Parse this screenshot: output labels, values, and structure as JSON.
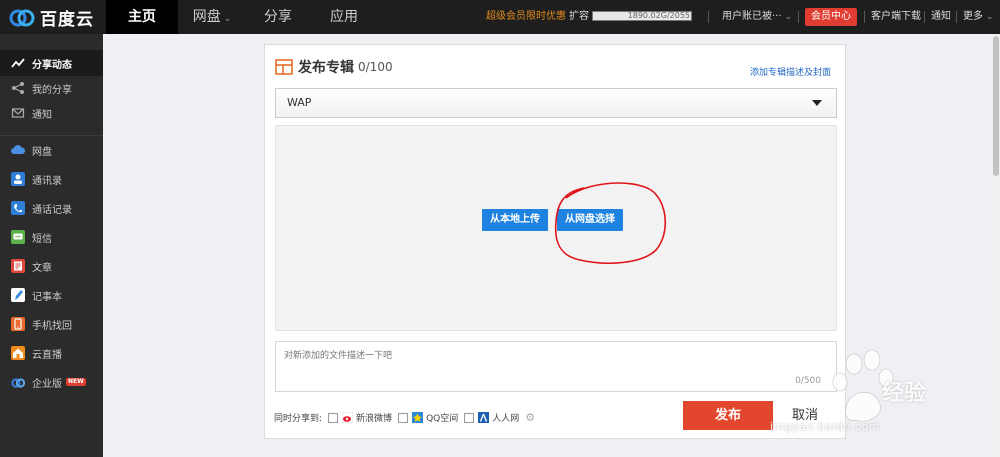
{
  "app": {
    "brand": "百度云",
    "nav": [
      {
        "label": "主页",
        "active": true
      },
      {
        "label": "网盘",
        "dropdown": true
      },
      {
        "label": "分享"
      },
      {
        "label": "应用"
      }
    ],
    "promo_vip": "超级会员",
    "promo_offer": "限时优惠",
    "quota_label": "扩容",
    "quota_text": "1890.02G/2055",
    "user_label": "用户账已被···",
    "vip_center": "会员中心",
    "client_download": "客户端下载",
    "notify": "通知",
    "more": "更多"
  },
  "sidebar": {
    "items": [
      {
        "label": "分享动态",
        "icon": "activity-icon",
        "active": true
      },
      {
        "label": "我的分享",
        "icon": "share-icon"
      },
      {
        "label": "通知",
        "icon": "mail-icon"
      },
      {
        "label": "网盘",
        "icon": "cloud-icon",
        "color": "#4a90e2"
      },
      {
        "label": "通讯录",
        "icon": "contacts-icon",
        "color": "#2f7fd8"
      },
      {
        "label": "通话记录",
        "icon": "call-log-icon",
        "color": "#2f7fd8"
      },
      {
        "label": "短信",
        "icon": "sms-icon",
        "color": "#5bb04a"
      },
      {
        "label": "文章",
        "icon": "article-icon",
        "color": "#e0483d"
      },
      {
        "label": "记事本",
        "icon": "notepad-icon",
        "color": "#3a8ae0"
      },
      {
        "label": "手机找回",
        "icon": "phone-find-icon",
        "color": "#e86a2a"
      },
      {
        "label": "云直播",
        "icon": "live-icon",
        "color": "#f08a1c"
      },
      {
        "label": "企业版",
        "icon": "enterprise-icon",
        "color": "#3b7fe0",
        "badge": "NEW"
      }
    ]
  },
  "card": {
    "title": "发布专辑",
    "count": "0/100",
    "add_link": "添加专辑描述及封面",
    "select_value": "WAP",
    "upload_local": "从本地上传",
    "upload_netdisk": "从网盘选择",
    "desc_placeholder": "对新添加的文件描述一下吧",
    "char_count": "0/500",
    "share_label": "同时分享到:",
    "share_targets": [
      "新浪微博",
      "QQ空间",
      "人人网"
    ],
    "publish": "发布",
    "cancel": "取消"
  },
  "watermark": {
    "brand": "经验",
    "url": "jingyan.baidu.com"
  },
  "colors": {
    "accent_blue": "#1d82e0",
    "publish_red": "#e2462d",
    "vip_red": "#e03c31",
    "promo_orange": "#e08a1e",
    "annotation_red": "#e0151b"
  }
}
